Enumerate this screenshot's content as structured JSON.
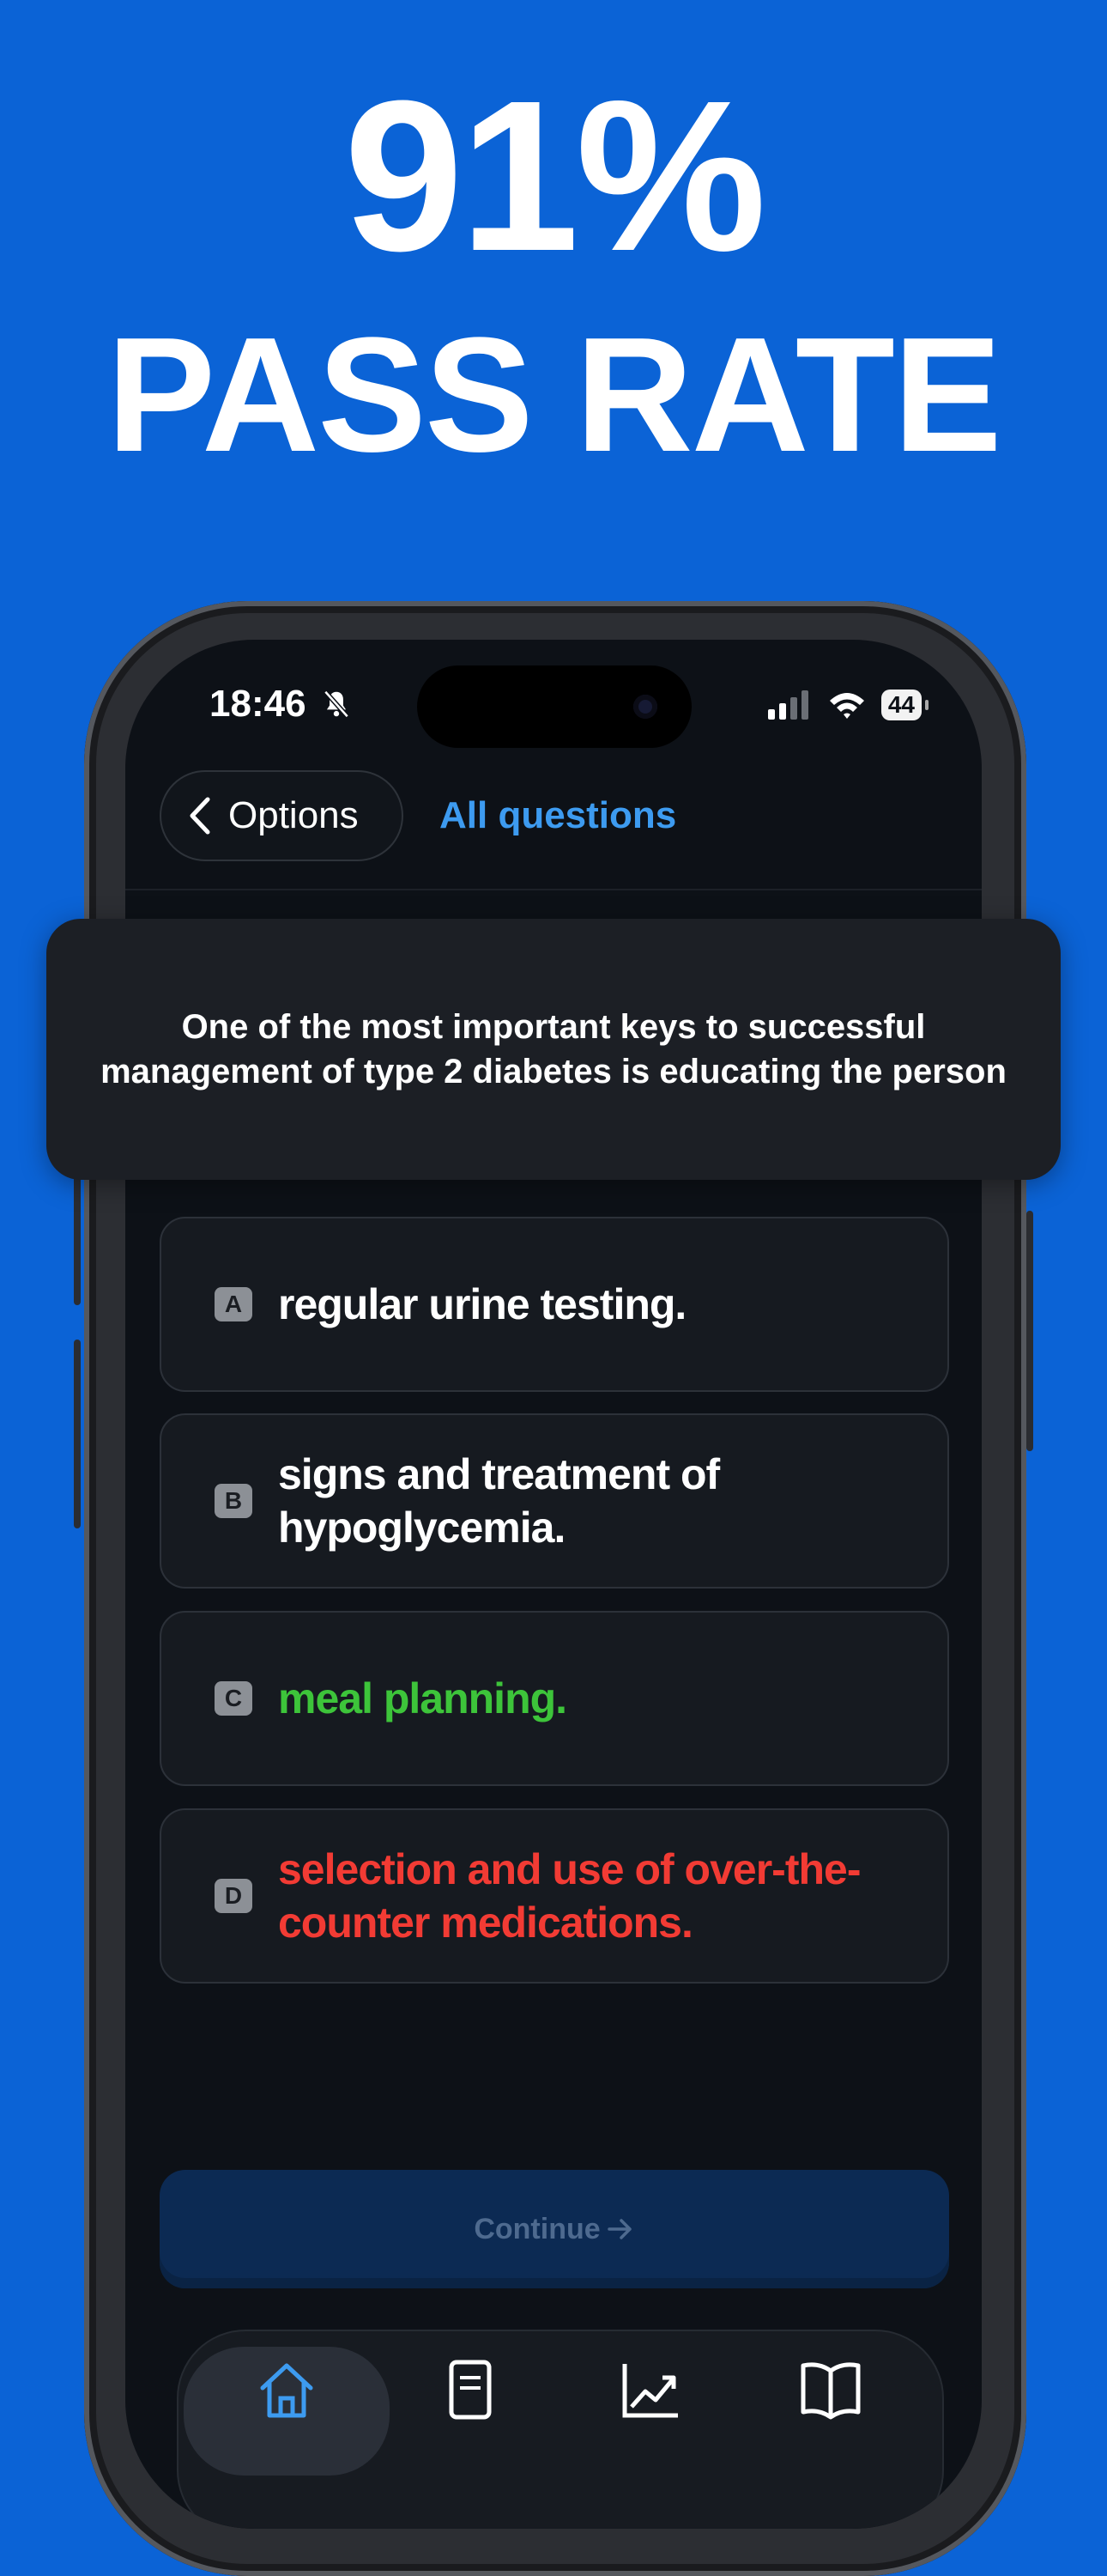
{
  "headline": {
    "line1": "91%",
    "line2": "PASS RATE"
  },
  "status_bar": {
    "time": "18:46",
    "battery": "44"
  },
  "nav": {
    "back_label": "Options",
    "title_link": "All questions"
  },
  "question": {
    "text": "One of the most important keys to successful management of type 2 diabetes is educating the person"
  },
  "options": [
    {
      "letter": "A",
      "text": "regular urine testing.",
      "state": "default",
      "color": "#ffffff"
    },
    {
      "letter": "B",
      "text": "signs and treatment of hypoglycemia.",
      "state": "default",
      "color": "#ffffff"
    },
    {
      "letter": "C",
      "text": "meal planning.",
      "state": "correct",
      "color": "#3dc43a"
    },
    {
      "letter": "D",
      "text": "selection and use of over-the-counter medications.",
      "state": "incorrect",
      "color": "#f23b34"
    }
  ],
  "continue_button": {
    "label": "Continue"
  },
  "tabbar": {
    "tabs": [
      {
        "icon": "home-icon",
        "active": true
      },
      {
        "icon": "document-icon",
        "active": false
      },
      {
        "icon": "stats-chart-icon",
        "active": false
      },
      {
        "icon": "book-icon",
        "active": false
      }
    ]
  },
  "colors": {
    "background": "#0b63d6",
    "accent": "#3d9bf0",
    "correct": "#3dc43a",
    "incorrect": "#f23b34"
  }
}
